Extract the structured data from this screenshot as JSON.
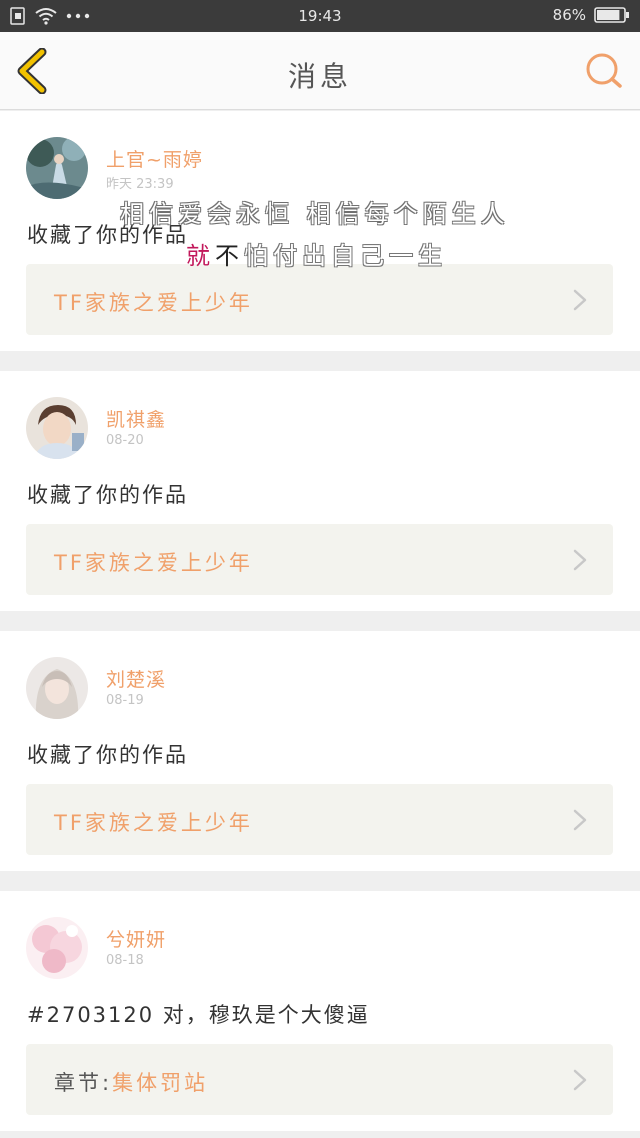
{
  "status_bar": {
    "time": "19:43",
    "battery": "86%",
    "battery_level": 0.86,
    "icons": [
      "sim-icon",
      "wifi-icon",
      "more-dots-icon",
      "battery-icon"
    ]
  },
  "nav": {
    "title": "消息",
    "back_icon": "chevron-left-icon",
    "search_icon": "search-icon",
    "accent_color": "#f0a06a",
    "back_color": "#f2c200"
  },
  "overlay": {
    "line1": "相信爱会永恒  相信每个陌生人",
    "line2_highlight_1": "就",
    "line2_highlight_2": "不",
    "line2_rest": "怕付出自己一生"
  },
  "messages": [
    {
      "username": "上官~雨婷",
      "date": "昨天   23:39",
      "text": "收藏了你的作品",
      "work_prefix": "",
      "work_title": "TF家族之爱上少年"
    },
    {
      "username": "凯祺鑫",
      "date": "08-20",
      "text": "收藏了你的作品",
      "work_prefix": "",
      "work_title": "TF家族之爱上少年"
    },
    {
      "username": "刘楚溪",
      "date": "08-19",
      "text": "收藏了你的作品",
      "work_prefix": "",
      "work_title": "TF家族之爱上少年"
    },
    {
      "username": "兮妍妍",
      "date": "08-18",
      "text": "#2703120  对，穆玖是个大傻逼",
      "work_prefix": "章节:",
      "work_title": "集体罚站"
    }
  ]
}
